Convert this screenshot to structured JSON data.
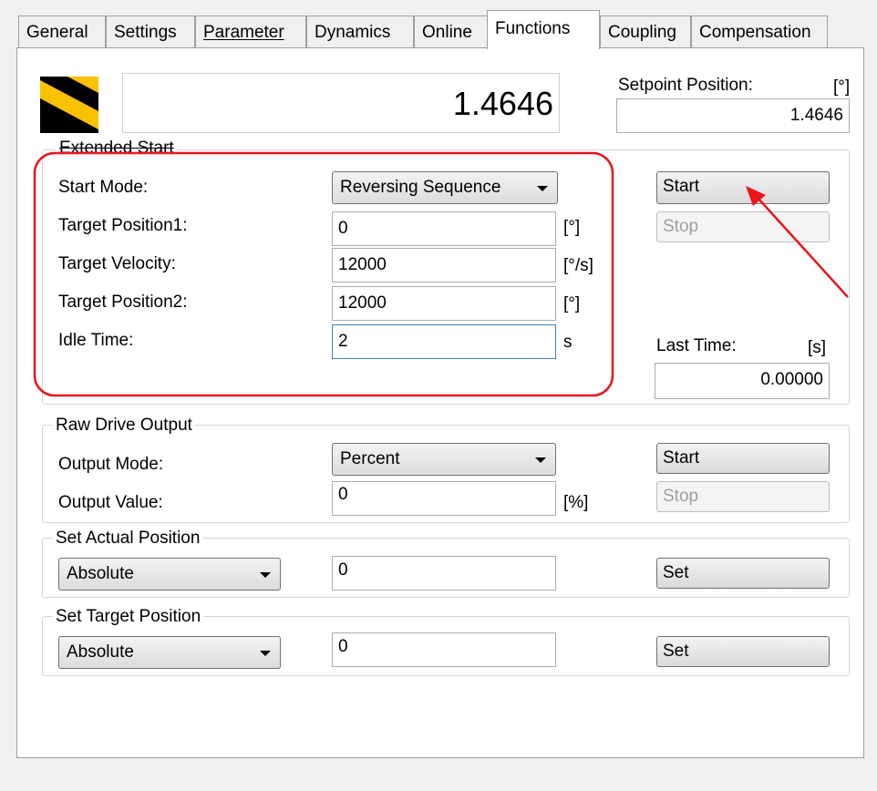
{
  "tabs": [
    {
      "label": "General",
      "u": ""
    },
    {
      "label": "Settings",
      "u": ""
    },
    {
      "label": "Parameter",
      "u": "P"
    },
    {
      "label": "Dynamics",
      "u": "D"
    },
    {
      "label": "Online",
      "u": ""
    },
    {
      "label": "Functions",
      "u": "F"
    },
    {
      "label": "Coupling",
      "u": "C"
    },
    {
      "label": "Compensation",
      "u": ""
    }
  ],
  "active_tab": "Functions",
  "header": {
    "display_value": "1.4646",
    "setpoint_label": "Setpoint Position:",
    "setpoint_unit": "[°]",
    "setpoint_value": "1.4646"
  },
  "extended_start": {
    "title": "Extended Start",
    "start_mode_label": "Start Mode:",
    "start_mode_value": "Reversing Sequence",
    "target_position1_label": "Target Position1:",
    "target_position1_value": "0",
    "target_position1_unit": "[°]",
    "target_velocity_label": "Target Velocity:",
    "target_velocity_value": "12000",
    "target_velocity_unit": "[°/s]",
    "target_position2_label": "Target Position2:",
    "target_position2_value": "12000",
    "target_position2_unit": "[°]",
    "idle_time_label": "Idle Time:",
    "idle_time_value": "2",
    "idle_time_unit": "s",
    "start_button": "Start",
    "stop_button": "Stop",
    "last_time_label": "Last Time:",
    "last_time_unit": "[s]",
    "last_time_value": "0.00000"
  },
  "raw_drive": {
    "title": "Raw Drive Output",
    "output_mode_label": "Output Mode:",
    "output_mode_value": "Percent",
    "output_value_label": "Output Value:",
    "output_value": "0",
    "output_value_unit": "[%]",
    "start_button": "Start",
    "stop_button": "Stop"
  },
  "set_actual": {
    "title": "Set Actual Position",
    "mode_value": "Absolute",
    "value": "0",
    "set_button": "Set"
  },
  "set_target": {
    "title": "Set Target Position",
    "mode_value": "Absolute",
    "value": "0",
    "set_button": "Set"
  },
  "colors": {
    "highlight": "#e8161b",
    "logo_yellow": "#f8c200",
    "logo_black": "#000000"
  }
}
